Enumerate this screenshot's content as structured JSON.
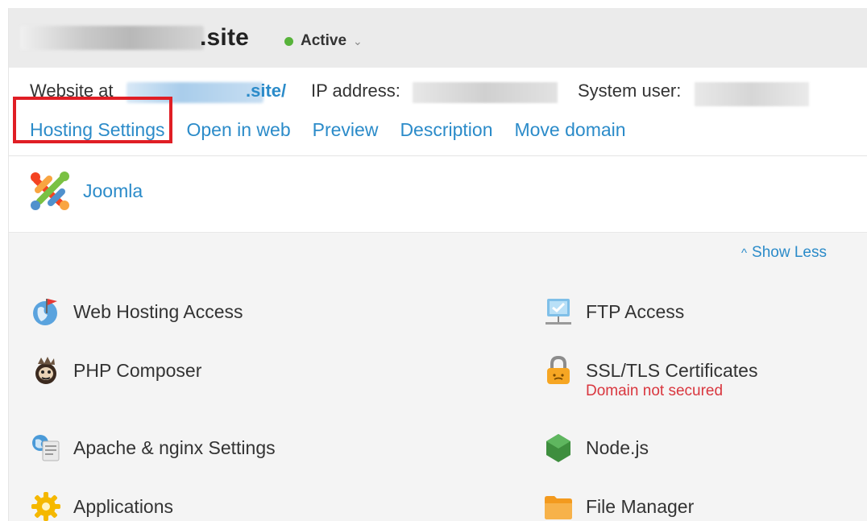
{
  "header": {
    "domain_suffix": ".site",
    "status": "Active"
  },
  "info": {
    "website_label": "Website at",
    "url_suffix": ".site/",
    "ip_label": "IP address:",
    "system_user_label": "System user:"
  },
  "links": [
    {
      "label": "Hosting Settings"
    },
    {
      "label": "Open in web"
    },
    {
      "label": "Preview"
    },
    {
      "label": "Description"
    },
    {
      "label": "Move domain"
    }
  ],
  "app": {
    "name": "Joomla",
    "icon": "joomla-icon"
  },
  "tools_header": {
    "show_less": "Show Less"
  },
  "tools": [
    {
      "label": "Web Hosting Access",
      "icon": "web-hosting-access-icon"
    },
    {
      "label": "FTP Access",
      "icon": "ftp-access-icon"
    },
    {
      "label": "PHP Composer",
      "icon": "php-composer-icon"
    },
    {
      "label": "SSL/TLS Certificates",
      "icon": "ssl-lock-icon",
      "sub": "Domain not secured"
    },
    {
      "label": "Apache & nginx Settings",
      "icon": "apache-nginx-icon"
    },
    {
      "label": "Node.js",
      "icon": "nodejs-icon"
    },
    {
      "label": "Applications",
      "icon": "applications-gear-icon"
    },
    {
      "label": "File Manager",
      "icon": "folder-icon"
    }
  ],
  "colors": {
    "link": "#2b8bc9",
    "active": "#57b33a",
    "highlight": "#e01e25",
    "warning": "#d9363e"
  }
}
